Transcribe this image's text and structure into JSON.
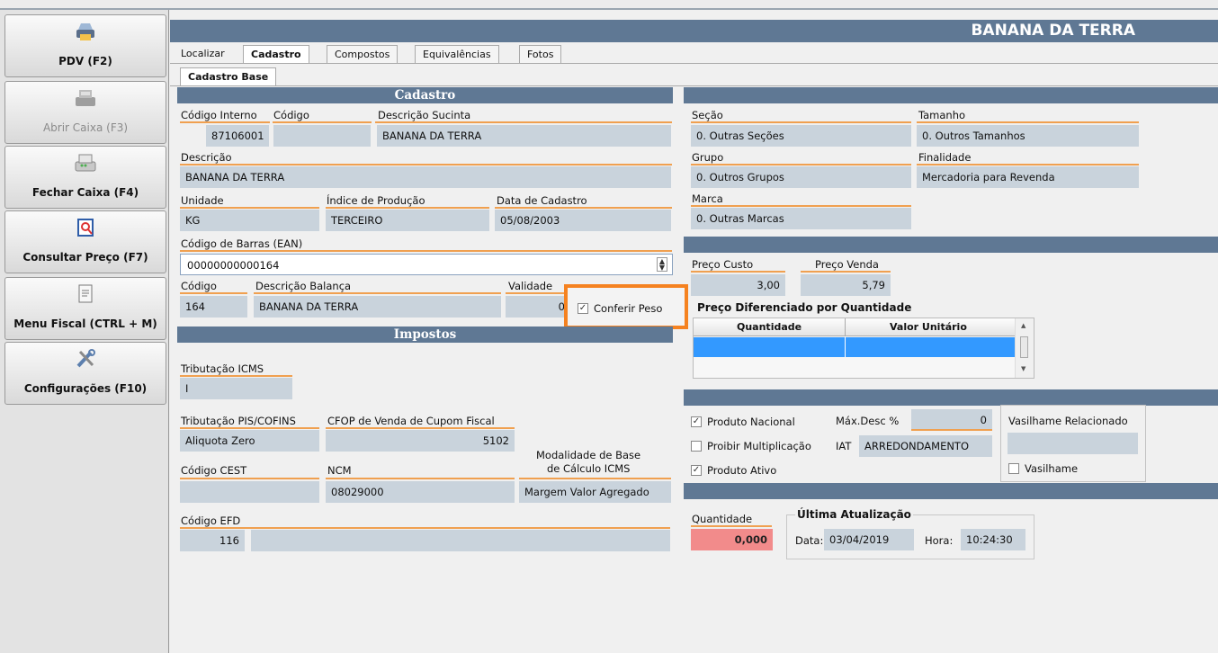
{
  "sidebar": {
    "buttons": [
      {
        "label": "PDV (F2)",
        "icon": "printer-icon",
        "enabled": true
      },
      {
        "label": "Abrir Caixa (F3)",
        "icon": "cash-register-icon",
        "enabled": false
      },
      {
        "label": "Fechar Caixa (F4)",
        "icon": "cash-register-icon",
        "enabled": true
      },
      {
        "label": "Consultar Preço (F7)",
        "icon": "magnifier-icon",
        "enabled": true
      },
      {
        "label": "Menu Fiscal (CTRL + M)",
        "icon": "document-icon",
        "enabled": true
      },
      {
        "label": "Configurações (F10)",
        "icon": "tools-icon",
        "enabled": true
      }
    ]
  },
  "header": {
    "title": "BANANA DA TERRA"
  },
  "tabs": [
    {
      "label": "Localizar"
    },
    {
      "label": "Cadastro"
    },
    {
      "label": "Compostos"
    },
    {
      "label": "Equivalências"
    },
    {
      "label": "Fotos"
    }
  ],
  "subtab": {
    "label": "Cadastro Base"
  },
  "cadastro": {
    "title": "Cadastro",
    "codigo_interno_label": "Código Interno",
    "codigo_interno": "87106001",
    "codigo_label": "Código",
    "codigo": "",
    "descricao_sucinta_label": "Descrição Sucinta",
    "descricao_sucinta": "BANANA DA TERRA",
    "descricao_label": "Descrição",
    "descricao": "BANANA DA TERRA",
    "unidade_label": "Unidade",
    "unidade": "KG",
    "indice_producao_label": "Índice de Produção",
    "indice_producao": "TERCEIRO",
    "data_cadastro_label": "Data de Cadastro",
    "data_cadastro": "05/08/2003",
    "codigo_barras_label": "Código de Barras (EAN)",
    "codigo_barras": "00000000000164",
    "codigo_balanca_label": "Código",
    "codigo_balanca": "164",
    "descricao_balanca_label": "Descrição Balança",
    "descricao_balanca": "BANANA DA TERRA",
    "validade_label": "Validade",
    "validade": "0",
    "conferir_peso_label": "Conferir Peso",
    "conferir_peso_checked": "✓"
  },
  "impostos": {
    "title": "Impostos",
    "tributacao_icms_label": "Tributação ICMS",
    "tributacao_icms": "I",
    "tributacao_pis_label": "Tributação PIS/COFINS",
    "tributacao_pis": "Aliquota Zero",
    "cfop_label": "CFOP de Venda de Cupom Fiscal",
    "cfop": "5102",
    "modalidade_label_1": "Modalidade de Base",
    "modalidade_label_2": "de Cálculo ICMS",
    "modalidade": "Margem Valor Agregado",
    "cest_label": "Código CEST",
    "cest": "",
    "ncm_label": "NCM",
    "ncm": "08029000",
    "efd_label": "Código EFD",
    "efd": "116",
    "efd_desc": ""
  },
  "classificacao": {
    "secao_label": "Seção",
    "secao": "0. Outras Seções",
    "tamanho_label": "Tamanho",
    "tamanho": "0. Outros Tamanhos",
    "grupo_label": "Grupo",
    "grupo": "0. Outros Grupos",
    "finalidade_label": "Finalidade",
    "finalidade": "Mercadoria para Revenda",
    "marca_label": "Marca",
    "marca": "0. Outras Marcas"
  },
  "precos": {
    "custo_label": "Preço Custo",
    "custo": "3,00",
    "venda_label": "Preço Venda",
    "venda": "5,79",
    "diferenciado_title": "Preço Diferenciado por Quantidade",
    "col_quantidade": "Quantidade",
    "col_valor": "Valor Unitário"
  },
  "flags": {
    "produto_nacional_label": "Produto Nacional",
    "produto_nacional_mark": "✓",
    "max_desc_label": "Máx.Desc %",
    "max_desc": "0",
    "proibir_mult_label": "Proibir Multiplicação",
    "proibir_mult_mark": "",
    "iat_label": "IAT",
    "iat": "ARREDONDAMENTO",
    "produto_ativo_label": "Produto Ativo",
    "produto_ativo_mark": "✓",
    "vasilhame_rel_label": "Vasilhame Relacionado",
    "vasilhame_rel": "",
    "vasilhame_label": "Vasilhame",
    "vasilhame_mark": ""
  },
  "estoque": {
    "quantidade_label": "Quantidade",
    "quantidade": "0,000",
    "ultima_title": "Última Atualização",
    "data_label": "Data:",
    "data": "03/04/2019",
    "hora_label": "Hora:",
    "hora": "10:24:30"
  },
  "colors": {
    "header": "#5f7894",
    "field": "#c9d3dc",
    "underline": "#f0a050",
    "highlight": "#f58220",
    "selection": "#3399ff",
    "quantity_bg": "#f28b8b"
  }
}
